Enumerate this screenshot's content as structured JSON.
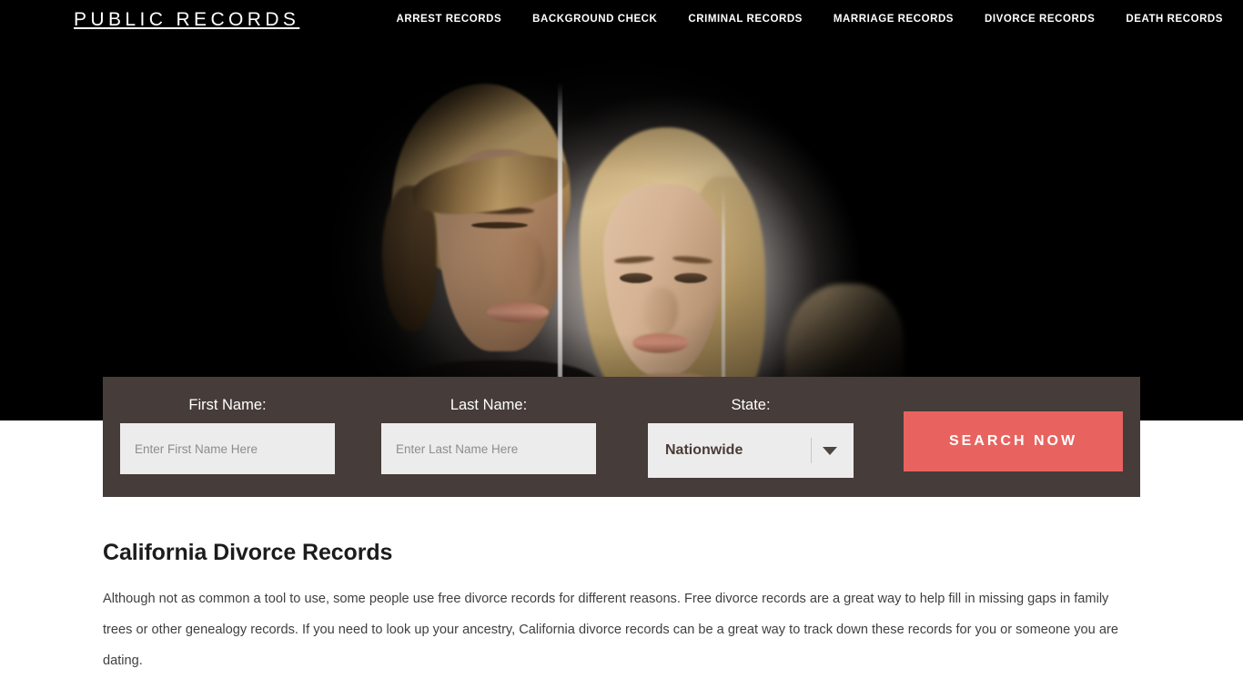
{
  "header": {
    "logo": "PUBLIC RECORDS",
    "nav": [
      {
        "label": "ARREST RECORDS"
      },
      {
        "label": "BACKGROUND CHECK"
      },
      {
        "label": "CRIMINAL RECORDS"
      },
      {
        "label": "MARRIAGE RECORDS"
      },
      {
        "label": "DIVORCE RECORDS"
      },
      {
        "label": "DEATH RECORDS"
      }
    ]
  },
  "hero": {
    "image_alt": "Couple back to back separated by a mirrored panel"
  },
  "search": {
    "first_name": {
      "label": "First Name:",
      "placeholder": "Enter First Name Here",
      "value": ""
    },
    "last_name": {
      "label": "Last Name:",
      "placeholder": "Enter Last Name Here",
      "value": ""
    },
    "state": {
      "label": "State:",
      "selected": "Nationwide"
    },
    "submit_label": "SEARCH NOW"
  },
  "main": {
    "heading": "California Divorce Records",
    "paragraph_1": "Although not as common a tool to use, some people use free divorce records for different reasons. Free divorce records are a great way to help fill in missing gaps in family trees or other genealogy records. If you need to look up your ancestry, California divorce records can be a great way to track down these records for you or someone you are dating.",
    "paragraph_2": ""
  },
  "colors": {
    "header_bg": "#000000",
    "panel_bg": "#463c39",
    "accent_button": "#e8635f",
    "input_bg": "#edecec",
    "page_bg": "#ffffff",
    "heading_text": "#1c1c1c"
  }
}
